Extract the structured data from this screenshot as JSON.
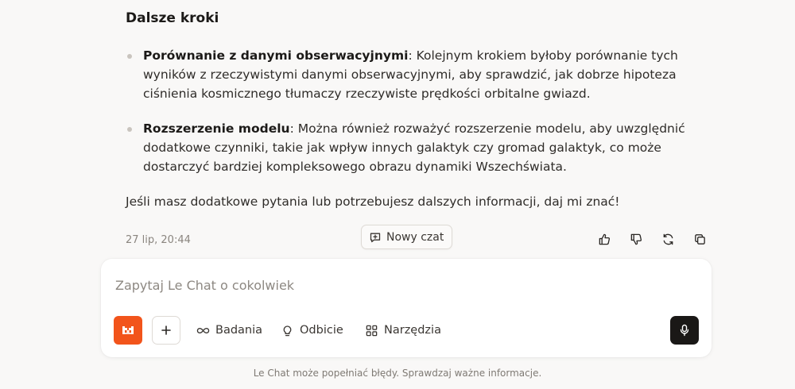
{
  "message": {
    "heading": "Dalsze kroki",
    "bullets": [
      {
        "title": "Porównanie z danymi obserwacyjnymi",
        "text": ": Kolejnym krokiem byłoby porównanie tych wyników z rzeczywistymi danymi obserwacyjnymi, aby sprawdzić, jak dobrze hipoteza ciśnienia kosmicznego tłumaczy rzeczywiste prędkości orbitalne gwiazd."
      },
      {
        "title": "Rozszerzenie modelu",
        "text": ": Można również rozważyć rozszerzenie modelu, aby uwzględnić dodatkowe czynniki, takie jak wpływ innych galaktyk czy gromad galaktyk, co może dostarczyć bardziej kompleksowego obrazu dynamiki Wszechświata."
      }
    ],
    "closing": "Jeśli masz dodatkowe pytania lub potrzebujesz dalszych informacji, daj mi znać!",
    "timestamp": "27 lip, 20:44"
  },
  "new_chat_label": "Nowy czat",
  "message_actions": [
    "thumbs-up-icon",
    "thumbs-down-icon",
    "regenerate-icon",
    "copy-icon"
  ],
  "composer": {
    "placeholder": "Zapytaj Le Chat o cokolwiek",
    "value": "",
    "tools": {
      "research": "Badania",
      "reflection": "Odbicie",
      "tools": "Narzędzia"
    }
  },
  "disclaimer": "Le Chat może popełniać błędy. Sprawdzaj ważne informacje.",
  "colors": {
    "accent": "#f2541b",
    "background": "#f9f8f7",
    "mic_button": "#1a1816"
  }
}
